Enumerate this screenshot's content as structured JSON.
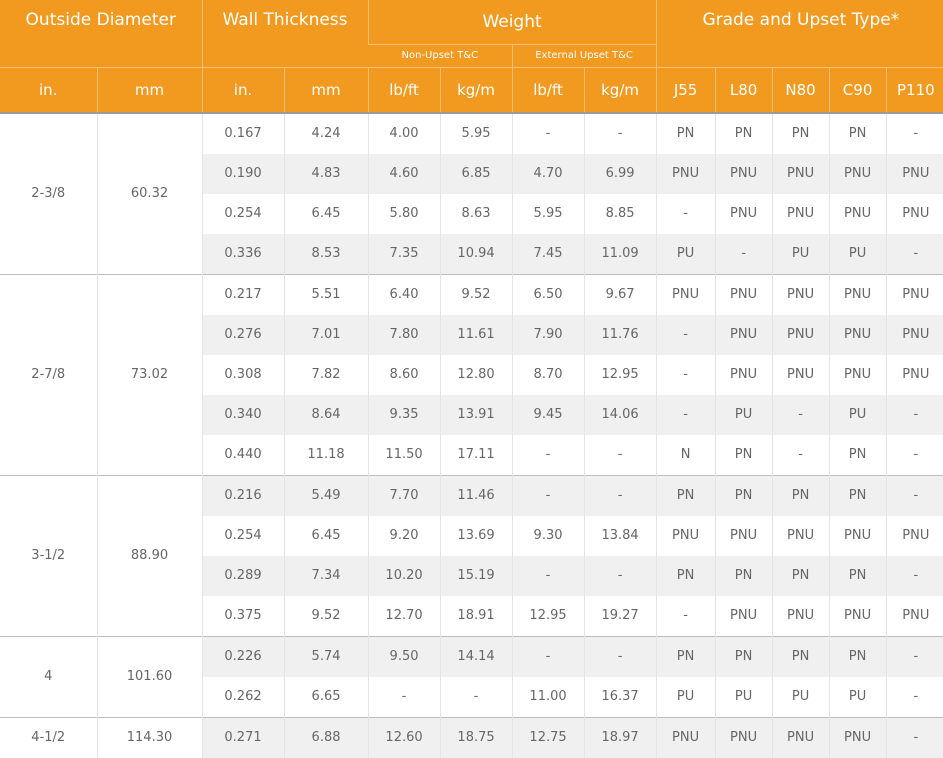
{
  "header": {
    "outside_diameter": "Outside Diameter",
    "wall_thickness": "Wall Thickness",
    "weight": "Weight",
    "grade_upset": "Grade and Upset Type*",
    "non_upset": "Non-Upset T&C",
    "external_upset": "External Upset T&C",
    "units": [
      "in.",
      "mm",
      "in.",
      "mm",
      "lb/ft",
      "kg/m",
      "lb/ft",
      "kg/m",
      "J55",
      "L80",
      "N80",
      "C90",
      "P110"
    ]
  },
  "groups": [
    {
      "od_in": "2-3/8",
      "od_mm": "60.32",
      "rows": [
        [
          "0.167",
          "4.24",
          "4.00",
          "5.95",
          "-",
          "-",
          "PN",
          "PN",
          "PN",
          "PN",
          "-"
        ],
        [
          "0.190",
          "4.83",
          "4.60",
          "6.85",
          "4.70",
          "6.99",
          "PNU",
          "PNU",
          "PNU",
          "PNU",
          "PNU"
        ],
        [
          "0.254",
          "6.45",
          "5.80",
          "8.63",
          "5.95",
          "8.85",
          "-",
          "PNU",
          "PNU",
          "PNU",
          "PNU"
        ],
        [
          "0.336",
          "8.53",
          "7.35",
          "10.94",
          "7.45",
          "11.09",
          "PU",
          "-",
          "PU",
          "PU",
          "-"
        ]
      ]
    },
    {
      "od_in": "2-7/8",
      "od_mm": "73.02",
      "rows": [
        [
          "0.217",
          "5.51",
          "6.40",
          "9.52",
          "6.50",
          "9.67",
          "PNU",
          "PNU",
          "PNU",
          "PNU",
          "PNU"
        ],
        [
          "0.276",
          "7.01",
          "7.80",
          "11.61",
          "7.90",
          "11.76",
          "-",
          "PNU",
          "PNU",
          "PNU",
          "PNU"
        ],
        [
          "0.308",
          "7.82",
          "8.60",
          "12.80",
          "8.70",
          "12.95",
          "-",
          "PNU",
          "PNU",
          "PNU",
          "PNU"
        ],
        [
          "0.340",
          "8.64",
          "9.35",
          "13.91",
          "9.45",
          "14.06",
          "-",
          "PU",
          "-",
          "PU",
          "-"
        ],
        [
          "0.440",
          "11.18",
          "11.50",
          "17.11",
          "-",
          "-",
          "N",
          "PN",
          "-",
          "PN",
          "-"
        ]
      ]
    },
    {
      "od_in": "3-1/2",
      "od_mm": "88.90",
      "rows": [
        [
          "0.216",
          "5.49",
          "7.70",
          "11.46",
          "-",
          "-",
          "PN",
          "PN",
          "PN",
          "PN",
          "-"
        ],
        [
          "0.254",
          "6.45",
          "9.20",
          "13.69",
          "9.30",
          "13.84",
          "PNU",
          "PNU",
          "PNU",
          "PNU",
          "PNU"
        ],
        [
          "0.289",
          "7.34",
          "10.20",
          "15.19",
          "-",
          "-",
          "PN",
          "PN",
          "PN",
          "PN",
          "-"
        ],
        [
          "0.375",
          "9.52",
          "12.70",
          "18.91",
          "12.95",
          "19.27",
          "-",
          "PNU",
          "PNU",
          "PNU",
          "PNU"
        ]
      ]
    },
    {
      "od_in": "4",
      "od_mm": "101.60",
      "rows": [
        [
          "0.226",
          "5.74",
          "9.50",
          "14.14",
          "-",
          "-",
          "PN",
          "PN",
          "PN",
          "PN",
          "-"
        ],
        [
          "0.262",
          "6.65",
          "-",
          "-",
          "11.00",
          "16.37",
          "PU",
          "PU",
          "PU",
          "PU",
          "-"
        ]
      ]
    },
    {
      "od_in": "4-1/2",
      "od_mm": "114.30",
      "rows": [
        [
          "0.271",
          "6.88",
          "12.60",
          "18.75",
          "12.75",
          "18.97",
          "PNU",
          "PNU",
          "PNU",
          "PNU",
          "-"
        ]
      ]
    }
  ]
}
